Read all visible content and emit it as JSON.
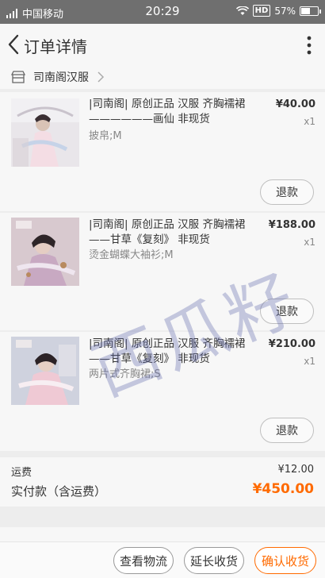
{
  "status_bar": {
    "carrier": "中国移动",
    "time": "20:29",
    "hd": "HD",
    "battery": "57%",
    "battery_level": 0.57
  },
  "header": {
    "title": "订单详情"
  },
  "shop": {
    "name": "司南阁汉服"
  },
  "items": [
    {
      "title": "|司南阁| 原创正品 汉服 齐胸襦裙 ——————画仙 非现货",
      "variant": "披帛;M",
      "price": "¥40.00",
      "qty": "x1",
      "refund_label": "退款"
    },
    {
      "title": "|司南阁| 原创正品 汉服 齐胸襦裙 ——甘草《复刻》 非现货",
      "variant": "烫金蝴蝶大袖衫;M",
      "price": "¥188.00",
      "qty": "x1",
      "refund_label": "退款"
    },
    {
      "title": "|司南阁| 原创正品 汉服 齐胸襦裙 ——甘草《复刻》 非现货",
      "variant": "两片式齐胸裙;S",
      "price": "¥210.00",
      "qty": "x1",
      "refund_label": "退款"
    }
  ],
  "totals": {
    "shipping_label": "运费",
    "shipping_value": "¥12.00",
    "paid_label": "实付款（含运费）",
    "paid_value": "¥450.00"
  },
  "bottom_bar": {
    "logistics": "查看物流",
    "extend": "延长收货",
    "confirm": "确认收货"
  },
  "watermark": "西瓜籽",
  "colors": {
    "accent": "#ff6a00",
    "status_bar": "#6f6f6f",
    "card": "#f7f7f7",
    "background": "#ededed"
  },
  "icons": {
    "back": "chevron-left-icon",
    "more": "more-vertical-icon",
    "shop": "store-icon",
    "shop_chevron": "chevron-right-icon"
  }
}
